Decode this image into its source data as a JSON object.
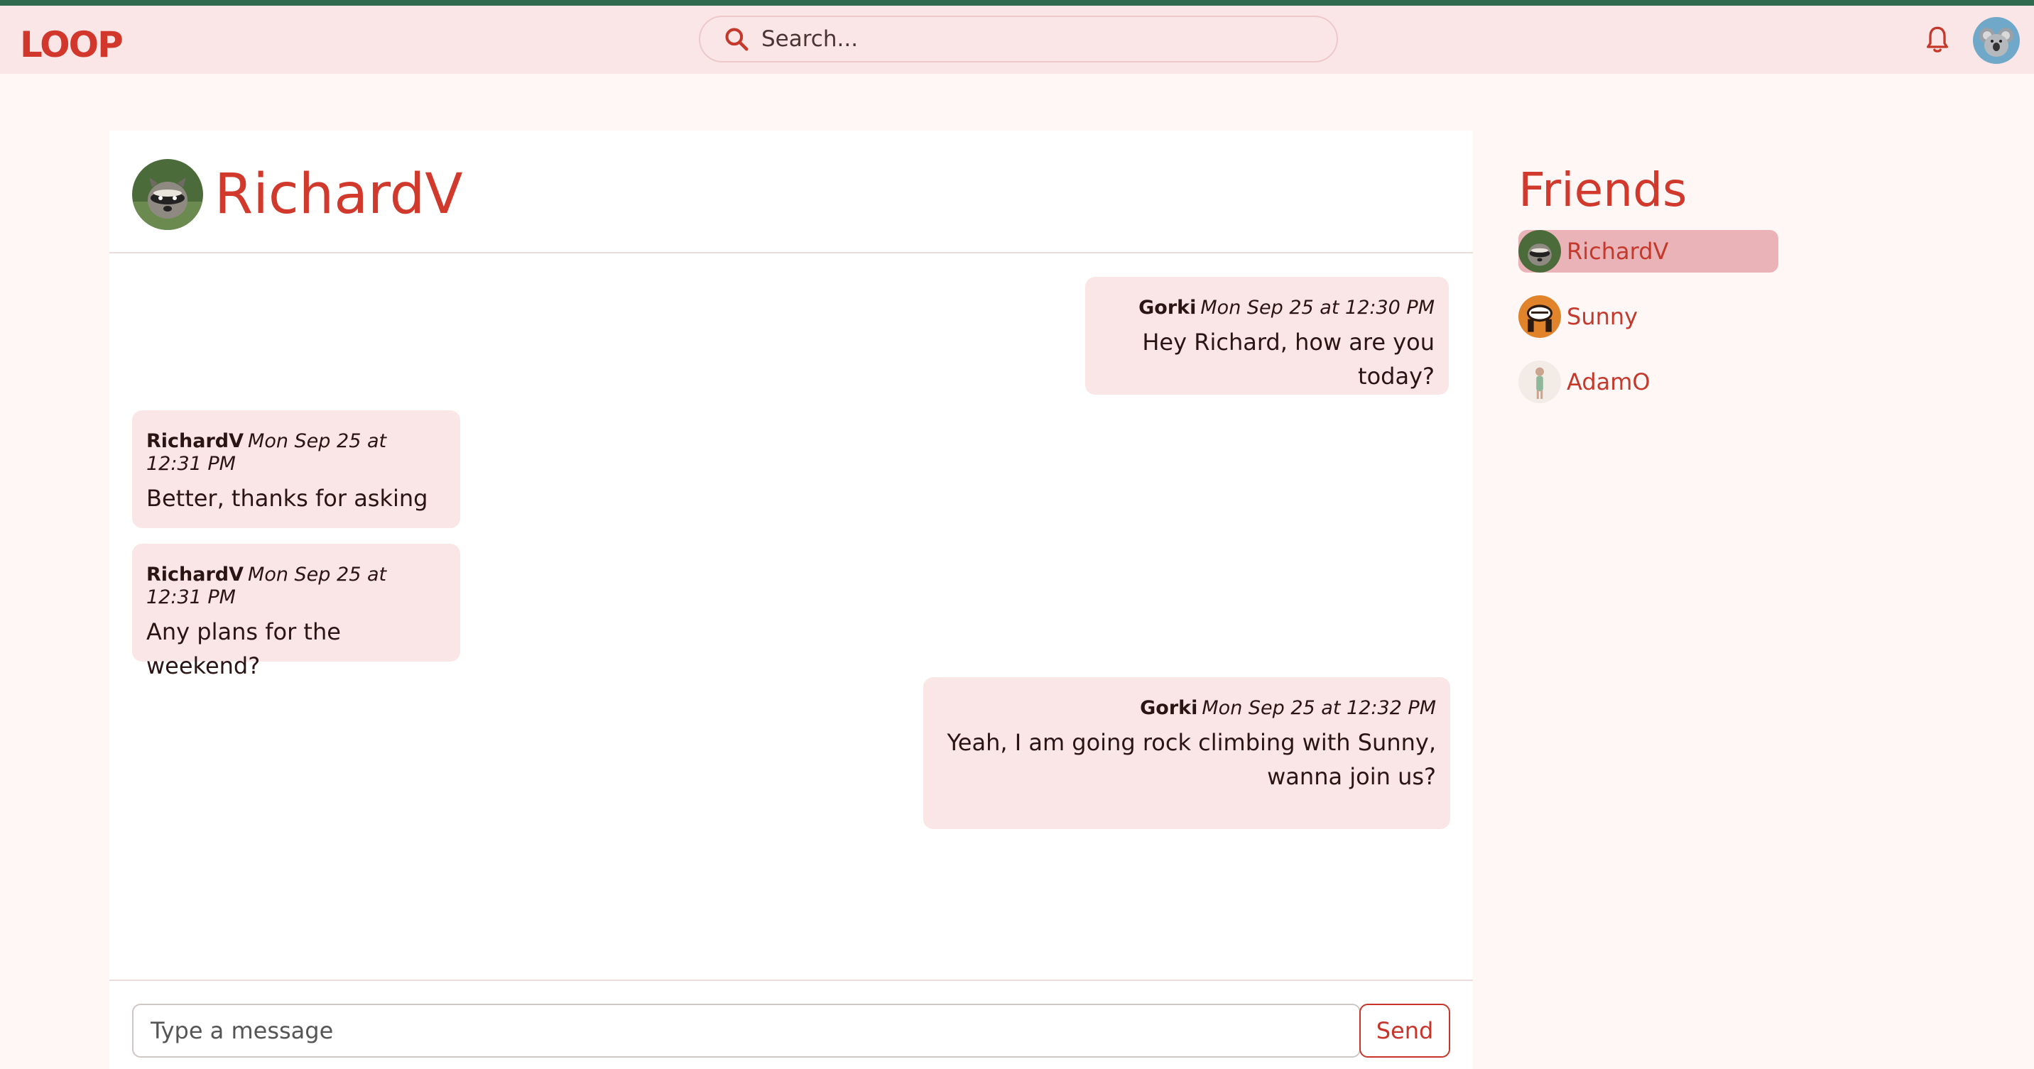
{
  "navbar": {
    "logo": "LOOP",
    "search_placeholder": "Search..."
  },
  "chat": {
    "title": "RichardV",
    "messages": [
      {
        "author": "Gorki",
        "time": "Mon Sep 25 at 12:30 PM",
        "lines": [
          "Hey Richard, how are you today?"
        ],
        "side": "right"
      },
      {
        "author": "RichardV",
        "time": "Mon Sep 25 at 12:31 PM",
        "lines": [
          "Better, thanks for asking"
        ],
        "side": "left"
      },
      {
        "author": "RichardV",
        "time": "Mon Sep 25 at 12:31 PM",
        "lines": [
          "Any plans for the weekend?"
        ],
        "side": "left"
      },
      {
        "author": "Gorki",
        "time": "Mon Sep 25 at 12:32 PM",
        "lines": [
          "Yeah, I am going rock climbing with Sunny,",
          "wanna join us?"
        ],
        "side": "right"
      }
    ],
    "composer": {
      "placeholder": "Type a message",
      "send_label": "Send"
    }
  },
  "friends": {
    "title": "Friends",
    "items": [
      {
        "name": "RichardV",
        "active": true
      },
      {
        "name": "Sunny",
        "active": false
      },
      {
        "name": "AdamO",
        "active": false
      }
    ]
  },
  "colors": {
    "accent": "#d0392b",
    "navbar_bg": "#fbe6e7",
    "bubble_bg": "#fbe6e7",
    "active_friend_bg": "#e9b3b7",
    "top_strip": "#2f6a4e"
  },
  "icons": {
    "search": "search-icon",
    "bell": "bell-icon"
  }
}
